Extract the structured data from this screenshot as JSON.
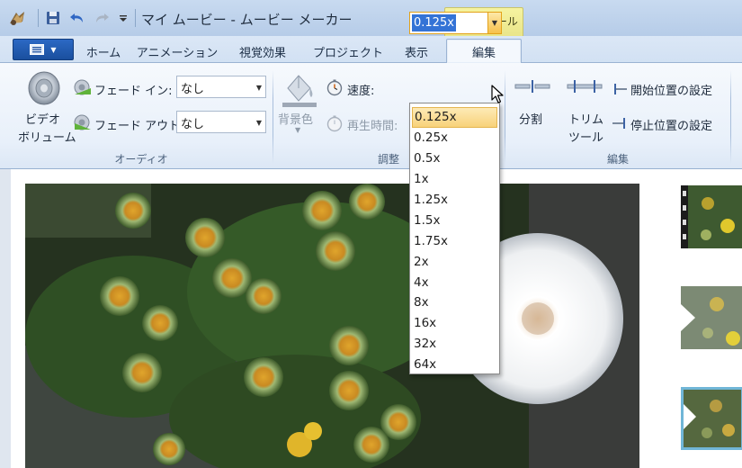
{
  "window": {
    "title": "マイ ムービー - ムービー メーカー",
    "context_tab": "ビデオ ツール"
  },
  "tabs": [
    {
      "label": "ホーム"
    },
    {
      "label": "アニメーション"
    },
    {
      "label": "視覚効果"
    },
    {
      "label": "プロジェクト"
    },
    {
      "label": "表示"
    },
    {
      "label": "編集",
      "active": true
    }
  ],
  "ribbon": {
    "audio": {
      "video_volume_label_1": "ビデオ",
      "video_volume_label_2": "ボリューム",
      "fade_in_label": "フェード イン:",
      "fade_in_value": "なし",
      "fade_out_label": "フェード アウト:",
      "fade_out_value": "なし",
      "group_label": "オーディオ"
    },
    "adjust": {
      "bg_color_label": "背景色",
      "speed_label": "速度:",
      "speed_value": "0.125x",
      "duration_label": "再生時間:",
      "group_label": "調整"
    },
    "edit": {
      "split_label": "分割",
      "trim_label_1": "トリム",
      "trim_label_2": "ツール",
      "set_start_label": "開始位置の設定",
      "set_end_label": "停止位置の設定",
      "group_label": "編集"
    }
  },
  "speed_dropdown": {
    "options": [
      "0.125x",
      "0.25x",
      "0.5x",
      "1x",
      "1.25x",
      "1.5x",
      "1.75x",
      "2x",
      "4x",
      "8x",
      "16x",
      "32x",
      "64x"
    ],
    "selected_index": 0
  },
  "colors": {
    "accent": "#2c69c4",
    "highlight": "#f8d27a",
    "selection_blue": "#3473d6"
  }
}
